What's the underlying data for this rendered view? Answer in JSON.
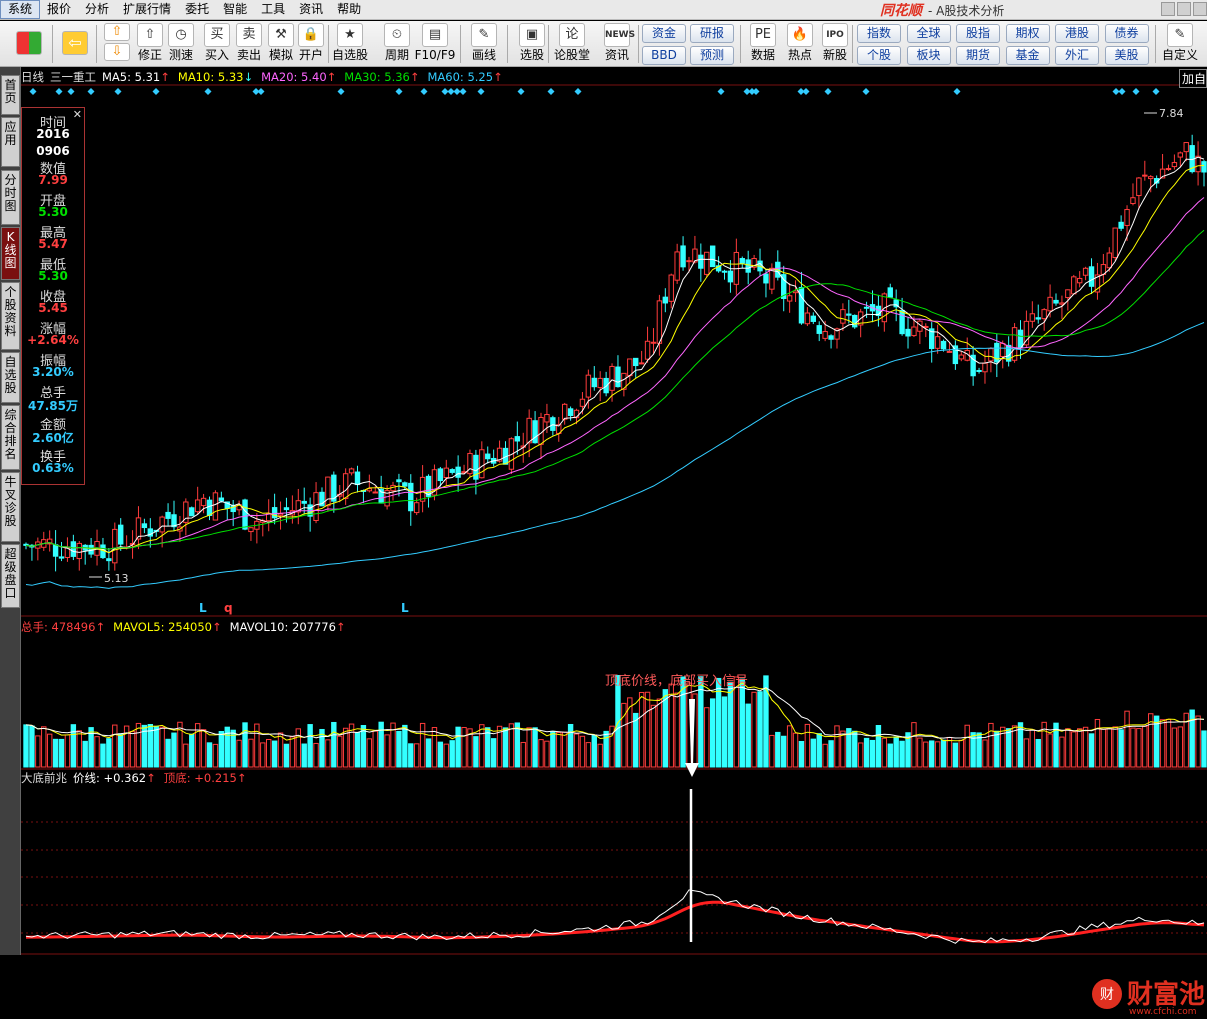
{
  "menu": [
    "系统",
    "报价",
    "分析",
    "扩展行情",
    "委托",
    "智能",
    "工具",
    "资讯",
    "帮助"
  ],
  "brand": {
    "logo": "同花顺",
    "subtitle": "- A股技术分析"
  },
  "toolbar": {
    "buttons": [
      {
        "label": "修正",
        "icon": "⇧"
      },
      {
        "label": "测速",
        "icon": "◷"
      },
      {
        "label": "买入",
        "icon": "买"
      },
      {
        "label": "卖出",
        "icon": "卖"
      },
      {
        "label": "模拟",
        "icon": "⚒"
      },
      {
        "label": "开户",
        "icon": "🔒"
      },
      {
        "label": "自选股",
        "icon": "★"
      },
      {
        "label": "周期",
        "icon": "⏲"
      },
      {
        "label": "F10/F9",
        "icon": "▤"
      },
      {
        "label": "画线",
        "icon": "✎"
      },
      {
        "label": "选股",
        "icon": "▣"
      },
      {
        "label": "论股堂",
        "icon": "论"
      },
      {
        "label": "资讯",
        "icon": "NEWS"
      },
      {
        "label": "数据",
        "icon": "PE"
      },
      {
        "label": "热点",
        "icon": "🔥"
      },
      {
        "label": "新股",
        "icon": "IPO"
      }
    ],
    "group1": [
      "资金",
      "研报",
      "BBD",
      "预测"
    ],
    "group2": [
      "指数",
      "全球",
      "股指",
      "期权",
      "港股",
      "债券",
      "个股",
      "板块",
      "期货",
      "基金",
      "外汇",
      "美股"
    ],
    "custom": "自定义"
  },
  "sidebar": [
    "首页",
    "应用",
    "分时图",
    "K线图",
    "个股资料",
    "自选股",
    "综合排名",
    "牛叉诊股",
    "超级盘口"
  ],
  "kline": {
    "period": "日线",
    "stock": "三一重工",
    "ma": [
      {
        "label": "MA5: 5.31",
        "arrow": "↑",
        "color": "#ffffff"
      },
      {
        "label": "MA10: 5.33",
        "arrow": "↓",
        "color": "#ffff00"
      },
      {
        "label": "MA20: 5.40",
        "arrow": "↑",
        "color": "#ff66ff"
      },
      {
        "label": "MA30: 5.36",
        "arrow": "↑",
        "color": "#00e000"
      },
      {
        "label": "MA60: 5.25",
        "arrow": "↑",
        "color": "#33ccff"
      }
    ],
    "high_marker": "7.84",
    "low_marker": "5.13",
    "add_button": "加自选",
    "bottom_marks": [
      "L",
      "q",
      "L"
    ]
  },
  "infobox": [
    {
      "label": "时间",
      "value": "2016",
      "color": "#ffffff"
    },
    {
      "label": "",
      "value": "0906",
      "color": "#ffffff"
    },
    {
      "label": "数值",
      "value": "7.99",
      "color": "#ff4040"
    },
    {
      "label": "开盘",
      "value": "5.30",
      "color": "#00e000"
    },
    {
      "label": "最高",
      "value": "5.47",
      "color": "#ff4040"
    },
    {
      "label": "最低",
      "value": "5.30",
      "color": "#00e000"
    },
    {
      "label": "收盘",
      "value": "5.45",
      "color": "#ff4040"
    },
    {
      "label": "涨幅",
      "value": "+2.64%",
      "color": "#ff4040"
    },
    {
      "label": "振幅",
      "value": "3.20%",
      "color": "#33ccff"
    },
    {
      "label": "总手",
      "value": "47.85万",
      "color": "#33ccff"
    },
    {
      "label": "金额",
      "value": "2.60亿",
      "color": "#33ccff"
    },
    {
      "label": "换手",
      "value": "0.63%",
      "color": "#33ccff"
    }
  ],
  "volume": {
    "items": [
      {
        "label": "总手: 478496",
        "arrow": "↑",
        "color": "#ff4040"
      },
      {
        "label": "MAVOL5: 254050",
        "arrow": "↑",
        "color": "#ffff00"
      },
      {
        "label": "MAVOL10: 207776",
        "arrow": "↑",
        "color": "#ffffff"
      }
    ],
    "annotation": "顶底价线，底部买入信号"
  },
  "indicator": {
    "name": "大底前兆",
    "items": [
      {
        "label": "价线: +0.362",
        "arrow": "↑",
        "color": "#ffffff"
      },
      {
        "label": "顶底: +0.215",
        "arrow": "↑",
        "color": "#ff4040"
      }
    ]
  },
  "watermark": {
    "brand": "财富池",
    "url": "www.cfchi.com"
  },
  "colors": {
    "up": "#ff3c3c",
    "down": "#33ffff",
    "ma5": "#ffffff",
    "ma10": "#ffff00",
    "ma20": "#ff66ff",
    "ma30": "#00e000",
    "ma60": "#33ccff",
    "grid": "#7a1010"
  }
}
